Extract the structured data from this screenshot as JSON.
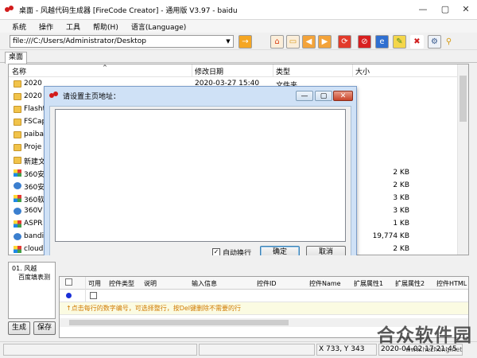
{
  "window": {
    "title": "桌面 - 风越代码生成器 [FireCode Creator] - 通用版 V3.97 - baidu",
    "minimize": "—",
    "maximize": "▢",
    "close": "✕"
  },
  "menu": [
    "系统",
    "操作",
    "工具",
    "帮助(H)",
    "语言(Language)"
  ],
  "address": {
    "value": "file:///C:/Users/Administrator/Desktop"
  },
  "tabs": [
    "桌面"
  ],
  "file_list": {
    "columns": [
      "名称",
      "修改日期",
      "类型",
      "大小"
    ],
    "rows": [
      {
        "name": "2020",
        "date": "2020-03-27 15:40",
        "type": "文件夹",
        "size": ""
      },
      {
        "name": "2020",
        "date": "",
        "type": "",
        "size": ""
      },
      {
        "name": "Flasht",
        "date": "",
        "type": "",
        "size": ""
      },
      {
        "name": "FSCap",
        "date": "",
        "type": "",
        "size": ""
      },
      {
        "name": "paiba",
        "date": "",
        "type": "",
        "size": ""
      },
      {
        "name": "Proje",
        "date": "",
        "type": "",
        "size": ""
      },
      {
        "name": "新建文",
        "date": "",
        "type": "",
        "size": ""
      },
      {
        "name": "360安",
        "date": "",
        "type": "",
        "size": "2 KB"
      },
      {
        "name": "360安",
        "date": "",
        "type": "",
        "size": "2 KB"
      },
      {
        "name": "360软",
        "date": "",
        "type": "",
        "size": "3 KB"
      },
      {
        "name": "360V",
        "date": "",
        "type": "",
        "size": "3 KB"
      },
      {
        "name": "ASPR",
        "date": "",
        "type": "",
        "size": "1 KB"
      },
      {
        "name": "bandi",
        "date": "",
        "type": "",
        "size": "19,774 KB"
      },
      {
        "name": "cloud",
        "date": "",
        "type": "",
        "size": "2 KB"
      }
    ]
  },
  "dialog": {
    "title": "请设置主页地址：",
    "textarea_value": "",
    "wrap_label": "自动换行",
    "wrap_checked": "✓",
    "ok_label": "确定",
    "cancel_label": "取消"
  },
  "tree": {
    "item1": "01. 风越",
    "item2": "百度填表测"
  },
  "lower_buttons": {
    "generate": "生成",
    "save": "保存"
  },
  "grid": {
    "columns": [
      "可用",
      "控件类型",
      "说明",
      "输入信息",
      "控件ID",
      "控件Name",
      "扩展属性1",
      "扩展属性2",
      "控件HTML"
    ],
    "hint": "↑点击每行的数字编号，可选择整行，按Del键删除不需要的行"
  },
  "status": {
    "coords": "X 733, Y 343",
    "time": "2020-04-02 17:21:45"
  },
  "watermark": {
    "text": "合众软件园",
    "url": "www.hezhong.net"
  }
}
